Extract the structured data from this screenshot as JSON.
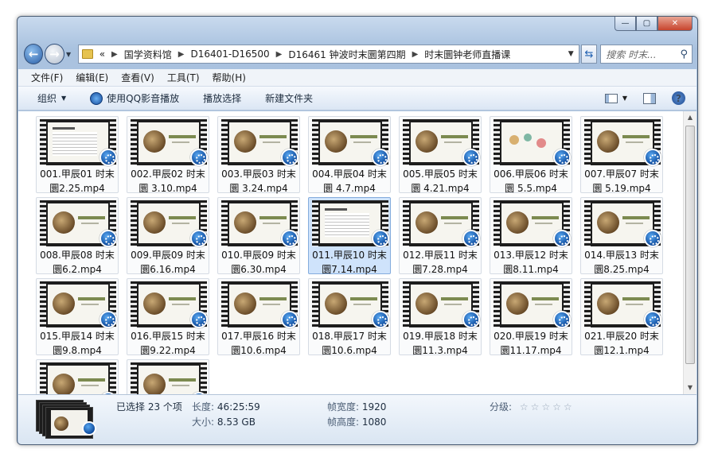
{
  "window": {
    "caption_buttons": [
      "—",
      "▢",
      "✕"
    ]
  },
  "nav": {
    "breadcrumb": [
      "«",
      "国学资料馆",
      "D16401-D16500",
      "D16461 钟波时末圜第四期",
      "时末圜钟老师直播课"
    ],
    "search_placeholder": "搜索 时末..."
  },
  "menu": [
    "文件(F)",
    "编辑(E)",
    "查看(V)",
    "工具(T)",
    "帮助(H)"
  ],
  "toolbar": {
    "organize": "组织",
    "play_qq": "使用QQ影音播放",
    "play_selection": "播放选择",
    "new_folder": "新建文件夹"
  },
  "files": [
    {
      "name": "001.甲辰01 时末\n圜2.25.mp4",
      "thumb": "doc"
    },
    {
      "name": "002.甲辰02 时末\n圜 3.10.mp4",
      "thumb": "moon"
    },
    {
      "name": "003.甲辰03 时末\n圜 3.24.mp4",
      "thumb": "moon"
    },
    {
      "name": "004.甲辰04 时末\n圜 4.7.mp4",
      "thumb": "moon"
    },
    {
      "name": "005.甲辰05 时末\n圜 4.21.mp4",
      "thumb": "moon"
    },
    {
      "name": "006.甲辰06 时末\n圜 5.5.mp4",
      "thumb": "dots"
    },
    {
      "name": "007.甲辰07 时末\n圜 5.19.mp4",
      "thumb": "moon"
    },
    {
      "name": "008.甲辰08 时末\n圜6.2.mp4",
      "thumb": "moon"
    },
    {
      "name": "009.甲辰09 时末\n圜6.16.mp4",
      "thumb": "moon"
    },
    {
      "name": "010.甲辰09 时末\n圜6.30.mp4",
      "thumb": "moon"
    },
    {
      "name": "011.甲辰10 时末\n圜7.14.mp4",
      "thumb": "doc",
      "selected": true
    },
    {
      "name": "012.甲辰11 时末\n圜7.28.mp4",
      "thumb": "moon"
    },
    {
      "name": "013.甲辰12 时末\n圜8.11.mp4",
      "thumb": "moon"
    },
    {
      "name": "014.甲辰13 时末\n圜8.25.mp4",
      "thumb": "moon"
    },
    {
      "name": "015.甲辰14 时末\n圜9.8.mp4",
      "thumb": "moon"
    },
    {
      "name": "016.甲辰15 时末\n圜9.22.mp4",
      "thumb": "moon"
    },
    {
      "name": "017.甲辰16 时末\n圜10.6.mp4",
      "thumb": "moon"
    },
    {
      "name": "018.甲辰17 时末\n圜10.6.mp4",
      "thumb": "moon"
    },
    {
      "name": "019.甲辰18 时末\n圜11.3.mp4",
      "thumb": "moon"
    },
    {
      "name": "020.甲辰19 时末\n圜11.17.mp4",
      "thumb": "moon"
    },
    {
      "name": "021.甲辰20 时末\n圜12.1.mp4",
      "thumb": "moon"
    },
    {
      "name": "",
      "thumb": "moon"
    },
    {
      "name": "",
      "thumb": "moon"
    }
  ],
  "details": {
    "selected": "已选择 23 个项",
    "length_label": "长度:",
    "length_value": "46:25:59",
    "size_label": "大小:",
    "size_value": "8.53 GB",
    "frame_width_label": "帧宽度:",
    "frame_width_value": "1920",
    "frame_height_label": "帧高度:",
    "frame_height_value": "1080",
    "rating_label": "分级:",
    "rating_stars": "☆☆☆☆☆"
  }
}
